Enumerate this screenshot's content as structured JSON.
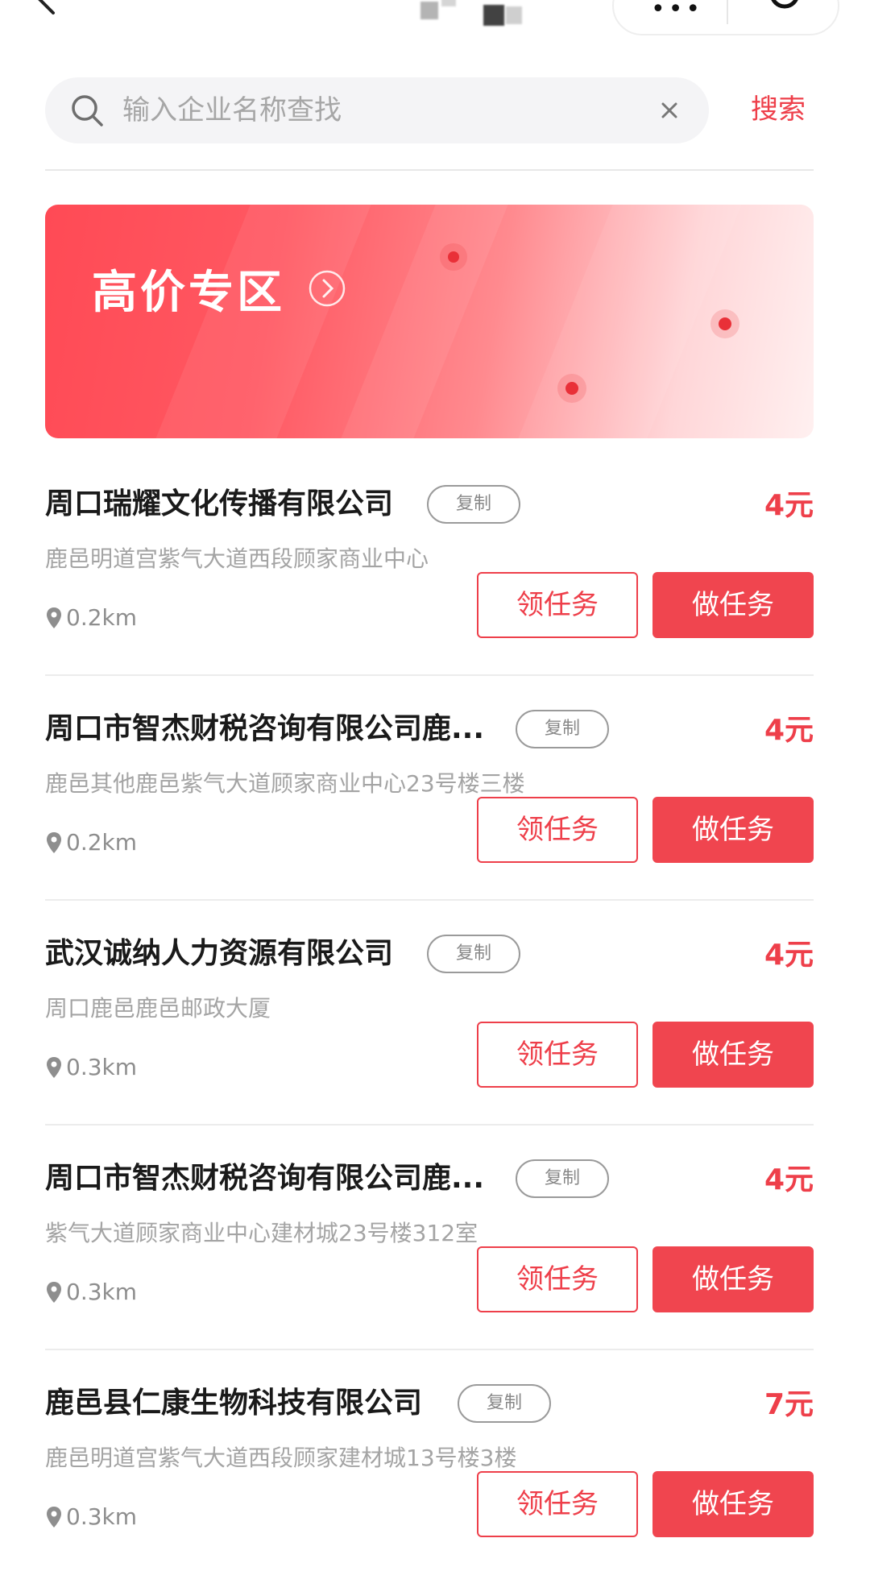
{
  "search": {
    "placeholder": "输入企业名称查找",
    "button_label": "搜索"
  },
  "banner": {
    "title": "高价专区"
  },
  "actions": {
    "claim_label": "领任务",
    "do_label": "做任务",
    "copy_label": "复制"
  },
  "items": [
    {
      "company": "周口瑞耀文化传播有限公司",
      "address": "鹿邑明道宫紫气大道西段顾家商业中心",
      "distance": "0.2km",
      "price": "4元"
    },
    {
      "company": "周口市智杰财税咨询有限公司鹿...",
      "address": "鹿邑其他鹿邑紫气大道顾家商业中心23号楼三楼",
      "distance": "0.2km",
      "price": "4元"
    },
    {
      "company": "武汉诚纳人力资源有限公司",
      "address": "周口鹿邑鹿邑邮政大厦",
      "distance": "0.3km",
      "price": "4元"
    },
    {
      "company": "周口市智杰财税咨询有限公司鹿...",
      "address": "紫气大道顾家商业中心建材城23号楼312室",
      "distance": "0.3km",
      "price": "4元"
    },
    {
      "company": "鹿邑县仁康生物科技有限公司",
      "address": "鹿邑明道宫紫气大道西段顾家建材城13号楼3楼",
      "distance": "0.3km",
      "price": "7元"
    }
  ],
  "colors": {
    "accent": "#ee3f4a",
    "banner_start": "#ff4a55",
    "banner_end": "#fff0f0"
  }
}
